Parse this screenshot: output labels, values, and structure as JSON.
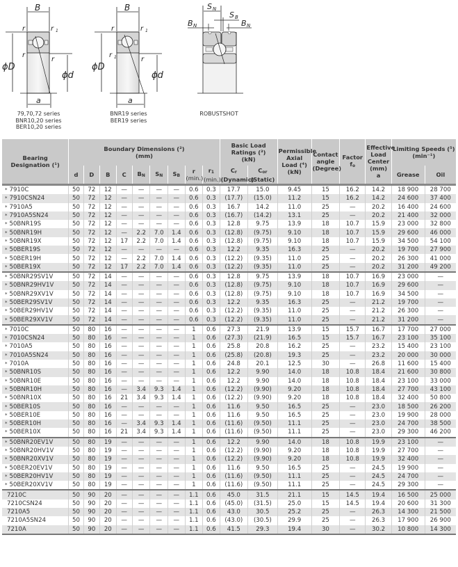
{
  "diagrams": [
    {
      "name": "diagram-79-70-72",
      "caption": [
        "79,70,72 series",
        "BNR10,20 series",
        "BER10,20 series"
      ],
      "labels": {
        "B": "B",
        "r": "r",
        "r1": "r",
        "r1_sub": "1",
        "D": "ϕD",
        "d": "ϕd",
        "a": "a"
      }
    },
    {
      "name": "diagram-bnr19",
      "caption": [
        "BNR19 series",
        "BER19 series"
      ],
      "labels": {
        "B": "B",
        "r": "r",
        "r1": "r",
        "r1_sub": "1",
        "D": "ϕD",
        "d": "ϕd",
        "a": "a"
      }
    },
    {
      "name": "diagram-robustshot",
      "caption": [
        "ROBUSTSHOT"
      ],
      "labels": {
        "SN": "S",
        "SN_sub": "N",
        "SB": "S",
        "SB_sub": "B",
        "BN": "B",
        "BN_sub": "N"
      }
    }
  ],
  "table": {
    "headers": {
      "designation": "Bearing Designation (¹)",
      "boundary": "Boundary Dimensions (²)",
      "boundary_unit": "(mm)",
      "load": "Basic Load Ratings (³)",
      "load_unit": "(kN)",
      "axial": "Permissible Axial Load (⁴) (kN)",
      "contact": "Contact angle (Degree)",
      "factor": "Factor",
      "factor_sub": "f",
      "factor_sub2": "o",
      "center": "Effective Load Center (mm)",
      "center_sub": "a",
      "speeds": "Limiting Speeds (⁵)",
      "speeds_unit": "(min⁻¹)",
      "cols": {
        "d": "d",
        "D": "D",
        "B": "B",
        "C": "C",
        "BN": "B",
        "BN_sub": "N",
        "SN": "S",
        "SN_sub": "N",
        "SB": "S",
        "SB_sub": "B",
        "r": "r",
        "r_min": "(min.)",
        "r1": "r",
        "r1_sub": "1",
        "r1_min": "(min.)",
        "Cr": "C",
        "Cr_sub": "r",
        "Cr_note": "(Dynamic)",
        "Cor": "C",
        "Cor_sub": "or",
        "Cor_note": "(Static)",
        "grease": "Grease",
        "oil": "Oil"
      }
    },
    "rows": [
      {
        "star": "*",
        "des": "7910C",
        "d": "50",
        "D": "72",
        "B": "12",
        "C": "—",
        "BN": "—",
        "SN": "—",
        "SB": "—",
        "r": "0.6",
        "r1": "0.3",
        "Cr": "17.7",
        "Cor": "15.0",
        "axial": "9.45",
        "angle": "15",
        "fo": "16.2",
        "a": "14.2",
        "grease": "18 900",
        "oil": "28 700"
      },
      {
        "star": "*",
        "des": "7910CSN24",
        "d": "50",
        "D": "72",
        "B": "12",
        "C": "—",
        "BN": "—",
        "SN": "—",
        "SB": "—",
        "r": "0.6",
        "r1": "0.3",
        "Cr": "(17.7)",
        "Cor": "(15.0)",
        "axial": "11.2",
        "angle": "15",
        "fo": "16.2",
        "a": "14.2",
        "grease": "24 600",
        "oil": "37 400"
      },
      {
        "star": "*",
        "des": "7910A5",
        "d": "50",
        "D": "72",
        "B": "12",
        "C": "—",
        "BN": "—",
        "SN": "—",
        "SB": "—",
        "r": "0.6",
        "r1": "0.3",
        "Cr": "16.7",
        "Cor": "14.2",
        "axial": "11.0",
        "angle": "25",
        "fo": "—",
        "a": "20.2",
        "grease": "16 400",
        "oil": "24 600"
      },
      {
        "star": "*",
        "des": "7910A5SN24",
        "d": "50",
        "D": "72",
        "B": "12",
        "C": "—",
        "BN": "—",
        "SN": "—",
        "SB": "—",
        "r": "0.6",
        "r1": "0.3",
        "Cr": "(16.7)",
        "Cor": "(14.2)",
        "axial": "13.1",
        "angle": "25",
        "fo": "—",
        "a": "20.2",
        "grease": "21 400",
        "oil": "32 000"
      },
      {
        "star": "*",
        "des": "50BNR19S",
        "d": "50",
        "D": "72",
        "B": "12",
        "C": "—",
        "BN": "—",
        "SN": "—",
        "SB": "—",
        "r": "0.6",
        "r1": "0.3",
        "Cr": "12.8",
        "Cor": "9.75",
        "axial": "13.9",
        "angle": "18",
        "fo": "10.7",
        "a": "15.9",
        "grease": "23 000",
        "oil": "32 800"
      },
      {
        "star": "*",
        "des": "50BNR19H",
        "d": "50",
        "D": "72",
        "B": "12",
        "C": "—",
        "BN": "2.2",
        "SN": "7.0",
        "SB": "1.4",
        "r": "0.6",
        "r1": "0.3",
        "Cr": "(12.8)",
        "Cor": "(9.75)",
        "axial": "9.10",
        "angle": "18",
        "fo": "10.7",
        "a": "15.9",
        "grease": "29 600",
        "oil": "46 000"
      },
      {
        "star": "*",
        "des": "50BNR19X",
        "d": "50",
        "D": "72",
        "B": "12",
        "C": "17",
        "BN": "2.2",
        "SN": "7.0",
        "SB": "1.4",
        "r": "0.6",
        "r1": "0.3",
        "Cr": "(12.8)",
        "Cor": "(9.75)",
        "axial": "9.10",
        "angle": "18",
        "fo": "10.7",
        "a": "15.9",
        "grease": "34 500",
        "oil": "54 100"
      },
      {
        "star": "*",
        "des": "50BER19S",
        "d": "50",
        "D": "72",
        "B": "12",
        "C": "—",
        "BN": "—",
        "SN": "—",
        "SB": "—",
        "r": "0.6",
        "r1": "0.3",
        "Cr": "12.2",
        "Cor": "9.35",
        "axial": "16.3",
        "angle": "25",
        "fo": "—",
        "a": "20.2",
        "grease": "19 700",
        "oil": "27 900"
      },
      {
        "star": "*",
        "des": "50BER19H",
        "d": "50",
        "D": "72",
        "B": "12",
        "C": "—",
        "BN": "2.2",
        "SN": "7.0",
        "SB": "1.4",
        "r": "0.6",
        "r1": "0.3",
        "Cr": "(12.2)",
        "Cor": "(9.35)",
        "axial": "11.0",
        "angle": "25",
        "fo": "—",
        "a": "20.2",
        "grease": "26 300",
        "oil": "41 000"
      },
      {
        "star": "*",
        "des": "50BER19X",
        "d": "50",
        "D": "72",
        "B": "12",
        "C": "17",
        "BN": "2.2",
        "SN": "7.0",
        "SB": "1.4",
        "r": "0.6",
        "r1": "0.3",
        "Cr": "(12.2)",
        "Cor": "(9.35)",
        "axial": "11.0",
        "angle": "25",
        "fo": "—",
        "a": "20.2",
        "grease": "31 200",
        "oil": "49 200",
        "group_end": true
      },
      {
        "star": "*",
        "des": "50BNR29SV1V",
        "d": "50",
        "D": "72",
        "B": "14",
        "C": "—",
        "BN": "—",
        "SN": "—",
        "SB": "—",
        "r": "0.6",
        "r1": "0.3",
        "Cr": "12.8",
        "Cor": "9.75",
        "axial": "13.9",
        "angle": "18",
        "fo": "10.7",
        "a": "16.9",
        "grease": "23 000",
        "oil": "—"
      },
      {
        "star": "*",
        "des": "50BNR29HV1V",
        "d": "50",
        "D": "72",
        "B": "14",
        "C": "—",
        "BN": "—",
        "SN": "—",
        "SB": "—",
        "r": "0.6",
        "r1": "0.3",
        "Cr": "(12.8)",
        "Cor": "(9.75)",
        "axial": "9.10",
        "angle": "18",
        "fo": "10.7",
        "a": "16.9",
        "grease": "29 600",
        "oil": "—"
      },
      {
        "star": "*",
        "des": "50BNR29XV1V",
        "d": "50",
        "D": "72",
        "B": "14",
        "C": "—",
        "BN": "—",
        "SN": "—",
        "SB": "—",
        "r": "0.6",
        "r1": "0.3",
        "Cr": "(12.8)",
        "Cor": "(9.75)",
        "axial": "9.10",
        "angle": "18",
        "fo": "10.7",
        "a": "16.9",
        "grease": "34 500",
        "oil": "—"
      },
      {
        "star": "*",
        "des": "50BER29SV1V",
        "d": "50",
        "D": "72",
        "B": "14",
        "C": "—",
        "BN": "—",
        "SN": "—",
        "SB": "—",
        "r": "0.6",
        "r1": "0.3",
        "Cr": "12.2",
        "Cor": "9.35",
        "axial": "16.3",
        "angle": "25",
        "fo": "—",
        "a": "21.2",
        "grease": "19 700",
        "oil": "—"
      },
      {
        "star": "*",
        "des": "50BER29HV1V",
        "d": "50",
        "D": "72",
        "B": "14",
        "C": "—",
        "BN": "—",
        "SN": "—",
        "SB": "—",
        "r": "0.6",
        "r1": "0.3",
        "Cr": "(12.2)",
        "Cor": "(9.35)",
        "axial": "11.0",
        "angle": "25",
        "fo": "—",
        "a": "21.2",
        "grease": "26 300",
        "oil": "—"
      },
      {
        "star": "*",
        "des": "50BER29XV1V",
        "d": "50",
        "D": "72",
        "B": "14",
        "C": "—",
        "BN": "—",
        "SN": "—",
        "SB": "—",
        "r": "0.6",
        "r1": "0.3",
        "Cr": "(12.2)",
        "Cor": "(9.35)",
        "axial": "11.0",
        "angle": "25",
        "fo": "—",
        "a": "21.2",
        "grease": "31 200",
        "oil": "—",
        "group_end": true
      },
      {
        "star": "*",
        "des": "7010C",
        "d": "50",
        "D": "80",
        "B": "16",
        "C": "—",
        "BN": "—",
        "SN": "—",
        "SB": "—",
        "r": "1",
        "r1": "0.6",
        "Cr": "27.3",
        "Cor": "21.9",
        "axial": "13.9",
        "angle": "15",
        "fo": "15.7",
        "a": "16.7",
        "grease": "17 700",
        "oil": "27 000"
      },
      {
        "star": "*",
        "des": "7010CSN24",
        "d": "50",
        "D": "80",
        "B": "16",
        "C": "—",
        "BN": "—",
        "SN": "—",
        "SB": "—",
        "r": "1",
        "r1": "0.6",
        "Cr": "(27.3)",
        "Cor": "(21.9)",
        "axial": "16.5",
        "angle": "15",
        "fo": "15.7",
        "a": "16.7",
        "grease": "23 100",
        "oil": "35 100"
      },
      {
        "star": "*",
        "des": "7010A5",
        "d": "50",
        "D": "80",
        "B": "16",
        "C": "—",
        "BN": "—",
        "SN": "—",
        "SB": "—",
        "r": "1",
        "r1": "0.6",
        "Cr": "25.8",
        "Cor": "20.8",
        "axial": "16.2",
        "angle": "25",
        "fo": "—",
        "a": "23.2",
        "grease": "15 400",
        "oil": "23 100"
      },
      {
        "star": "*",
        "des": "7010A5SN24",
        "d": "50",
        "D": "80",
        "B": "16",
        "C": "—",
        "BN": "—",
        "SN": "—",
        "SB": "—",
        "r": "1",
        "r1": "0.6",
        "Cr": "(25.8)",
        "Cor": "(20.8)",
        "axial": "19.3",
        "angle": "25",
        "fo": "—",
        "a": "23.2",
        "grease": "20 000",
        "oil": "30 000"
      },
      {
        "star": "*",
        "des": "7010A",
        "d": "50",
        "D": "80",
        "B": "16",
        "C": "—",
        "BN": "—",
        "SN": "—",
        "SB": "—",
        "r": "1",
        "r1": "0.6",
        "Cr": "24.8",
        "Cor": "20.1",
        "axial": "12.5",
        "angle": "30",
        "fo": "—",
        "a": "26.8",
        "grease": "11 600",
        "oil": "15 400"
      },
      {
        "star": "*",
        "des": "50BNR10S",
        "d": "50",
        "D": "80",
        "B": "16",
        "C": "—",
        "BN": "—",
        "SN": "—",
        "SB": "—",
        "r": "1",
        "r1": "0.6",
        "Cr": "12.2",
        "Cor": "9.90",
        "axial": "14.0",
        "angle": "18",
        "fo": "10.8",
        "a": "18.4",
        "grease": "21 600",
        "oil": "30 800"
      },
      {
        "star": "*",
        "des": "50BNR10E",
        "d": "50",
        "D": "80",
        "B": "16",
        "C": "—",
        "BN": "—",
        "SN": "—",
        "SB": "—",
        "r": "1",
        "r1": "0.6",
        "Cr": "12.2",
        "Cor": "9.90",
        "axial": "14.0",
        "angle": "18",
        "fo": "10.8",
        "a": "18.4",
        "grease": "23 100",
        "oil": "33 000"
      },
      {
        "star": "*",
        "des": "50BNR10H",
        "d": "50",
        "D": "80",
        "B": "16",
        "C": "—",
        "BN": "3.4",
        "SN": "9.3",
        "SB": "1.4",
        "r": "1",
        "r1": "0.6",
        "Cr": "(12.2)",
        "Cor": "(9.90)",
        "axial": "9.20",
        "angle": "18",
        "fo": "10.8",
        "a": "18.4",
        "grease": "27 700",
        "oil": "43 100"
      },
      {
        "star": "*",
        "des": "50BNR10X",
        "d": "50",
        "D": "80",
        "B": "16",
        "C": "21",
        "BN": "3.4",
        "SN": "9.3",
        "SB": "1.4",
        "r": "1",
        "r1": "0.6",
        "Cr": "(12.2)",
        "Cor": "(9.90)",
        "axial": "9.20",
        "angle": "18",
        "fo": "10.8",
        "a": "18.4",
        "grease": "32 400",
        "oil": "50 800"
      },
      {
        "star": "*",
        "des": "50BER10S",
        "d": "50",
        "D": "80",
        "B": "16",
        "C": "—",
        "BN": "—",
        "SN": "—",
        "SB": "—",
        "r": "1",
        "r1": "0.6",
        "Cr": "11.6",
        "Cor": "9.50",
        "axial": "16.5",
        "angle": "25",
        "fo": "—",
        "a": "23.0",
        "grease": "18 500",
        "oil": "26 200"
      },
      {
        "star": "*",
        "des": "50BER10E",
        "d": "50",
        "D": "80",
        "B": "16",
        "C": "—",
        "BN": "—",
        "SN": "—",
        "SB": "—",
        "r": "1",
        "r1": "0.6",
        "Cr": "11.6",
        "Cor": "9.50",
        "axial": "16.5",
        "angle": "25",
        "fo": "—",
        "a": "23.0",
        "grease": "19 900",
        "oil": "28 000"
      },
      {
        "star": "*",
        "des": "50BER10H",
        "d": "50",
        "D": "80",
        "B": "16",
        "C": "—",
        "BN": "3.4",
        "SN": "9.3",
        "SB": "1.4",
        "r": "1",
        "r1": "0.6",
        "Cr": "(11.6)",
        "Cor": "(9.50)",
        "axial": "11.1",
        "angle": "25",
        "fo": "—",
        "a": "23.0",
        "grease": "24 700",
        "oil": "38 500"
      },
      {
        "star": "*",
        "des": "50BER10X",
        "d": "50",
        "D": "80",
        "B": "16",
        "C": "21",
        "BN": "3.4",
        "SN": "9.3",
        "SB": "1.4",
        "r": "1",
        "r1": "0.6",
        "Cr": "(11.6)",
        "Cor": "(9.50)",
        "axial": "11.1",
        "angle": "25",
        "fo": "—",
        "a": "23.0",
        "grease": "29 300",
        "oil": "46 200",
        "group_end": true
      },
      {
        "star": "*",
        "des": "50BNR20EV1V",
        "d": "50",
        "D": "80",
        "B": "19",
        "C": "—",
        "BN": "—",
        "SN": "—",
        "SB": "—",
        "r": "1",
        "r1": "0.6",
        "Cr": "12.2",
        "Cor": "9.90",
        "axial": "14.0",
        "angle": "18",
        "fo": "10.8",
        "a": "19.9",
        "grease": "23 100",
        "oil": "—"
      },
      {
        "star": "*",
        "des": "50BNR20HV1V",
        "d": "50",
        "D": "80",
        "B": "19",
        "C": "—",
        "BN": "—",
        "SN": "—",
        "SB": "—",
        "r": "1",
        "r1": "0.6",
        "Cr": "(12.2)",
        "Cor": "(9.90)",
        "axial": "9.20",
        "angle": "18",
        "fo": "10.8",
        "a": "19.9",
        "grease": "27 700",
        "oil": "—"
      },
      {
        "star": "*",
        "des": "50BNR20XV1V",
        "d": "50",
        "D": "80",
        "B": "19",
        "C": "—",
        "BN": "—",
        "SN": "—",
        "SB": "—",
        "r": "1",
        "r1": "0.6",
        "Cr": "(12.2)",
        "Cor": "(9.90)",
        "axial": "9.20",
        "angle": "18",
        "fo": "10.8",
        "a": "19.9",
        "grease": "32 400",
        "oil": "—"
      },
      {
        "star": "*",
        "des": "50BER20EV1V",
        "d": "50",
        "D": "80",
        "B": "19",
        "C": "—",
        "BN": "—",
        "SN": "—",
        "SB": "—",
        "r": "1",
        "r1": "0.6",
        "Cr": "11.6",
        "Cor": "9.50",
        "axial": "16.5",
        "angle": "25",
        "fo": "—",
        "a": "24.5",
        "grease": "19 900",
        "oil": "—"
      },
      {
        "star": "*",
        "des": "50BER20HV1V",
        "d": "50",
        "D": "80",
        "B": "19",
        "C": "—",
        "BN": "—",
        "SN": "—",
        "SB": "—",
        "r": "1",
        "r1": "0.6",
        "Cr": "(11.6)",
        "Cor": "(9.50)",
        "axial": "11.1",
        "angle": "25",
        "fo": "—",
        "a": "24.5",
        "grease": "24 700",
        "oil": "—"
      },
      {
        "star": "*",
        "des": "50BER20XV1V",
        "d": "50",
        "D": "80",
        "B": "19",
        "C": "—",
        "BN": "—",
        "SN": "—",
        "SB": "—",
        "r": "1",
        "r1": "0.6",
        "Cr": "(11.6)",
        "Cor": "(9.50)",
        "axial": "11.1",
        "angle": "25",
        "fo": "—",
        "a": "24.5",
        "grease": "29 300",
        "oil": "—",
        "group_end": true
      },
      {
        "star": "",
        "des": "7210C",
        "d": "50",
        "D": "90",
        "B": "20",
        "C": "—",
        "BN": "—",
        "SN": "—",
        "SB": "—",
        "r": "1.1",
        "r1": "0.6",
        "Cr": "45.0",
        "Cor": "31.5",
        "axial": "21.1",
        "angle": "15",
        "fo": "14.5",
        "a": "19.4",
        "grease": "16 500",
        "oil": "25 000"
      },
      {
        "star": "",
        "des": "7210CSN24",
        "d": "50",
        "D": "90",
        "B": "20",
        "C": "—",
        "BN": "—",
        "SN": "—",
        "SB": "—",
        "r": "1.1",
        "r1": "0.6",
        "Cr": "(45.0)",
        "Cor": "(31.5)",
        "axial": "25.0",
        "angle": "15",
        "fo": "14.5",
        "a": "19.4",
        "grease": "20 600",
        "oil": "31 300"
      },
      {
        "star": "",
        "des": "7210A5",
        "d": "50",
        "D": "90",
        "B": "20",
        "C": "—",
        "BN": "—",
        "SN": "—",
        "SB": "—",
        "r": "1.1",
        "r1": "0.6",
        "Cr": "43.0",
        "Cor": "30.5",
        "axial": "25.2",
        "angle": "25",
        "fo": "—",
        "a": "26.3",
        "grease": "14 300",
        "oil": "21 500"
      },
      {
        "star": "",
        "des": "7210A5SN24",
        "d": "50",
        "D": "90",
        "B": "20",
        "C": "—",
        "BN": "—",
        "SN": "—",
        "SB": "—",
        "r": "1.1",
        "r1": "0.6",
        "Cr": "(43.0)",
        "Cor": "(30.5)",
        "axial": "29.9",
        "angle": "25",
        "fo": "—",
        "a": "26.3",
        "grease": "17 900",
        "oil": "26 900"
      },
      {
        "star": "",
        "des": "7210A",
        "d": "50",
        "D": "90",
        "B": "20",
        "C": "—",
        "BN": "—",
        "SN": "—",
        "SB": "—",
        "r": "1.1",
        "r1": "0.6",
        "Cr": "41.5",
        "Cor": "29.3",
        "axial": "19.4",
        "angle": "30",
        "fo": "—",
        "a": "30.2",
        "grease": "10 800",
        "oil": "14 300",
        "group_end": true
      }
    ]
  }
}
